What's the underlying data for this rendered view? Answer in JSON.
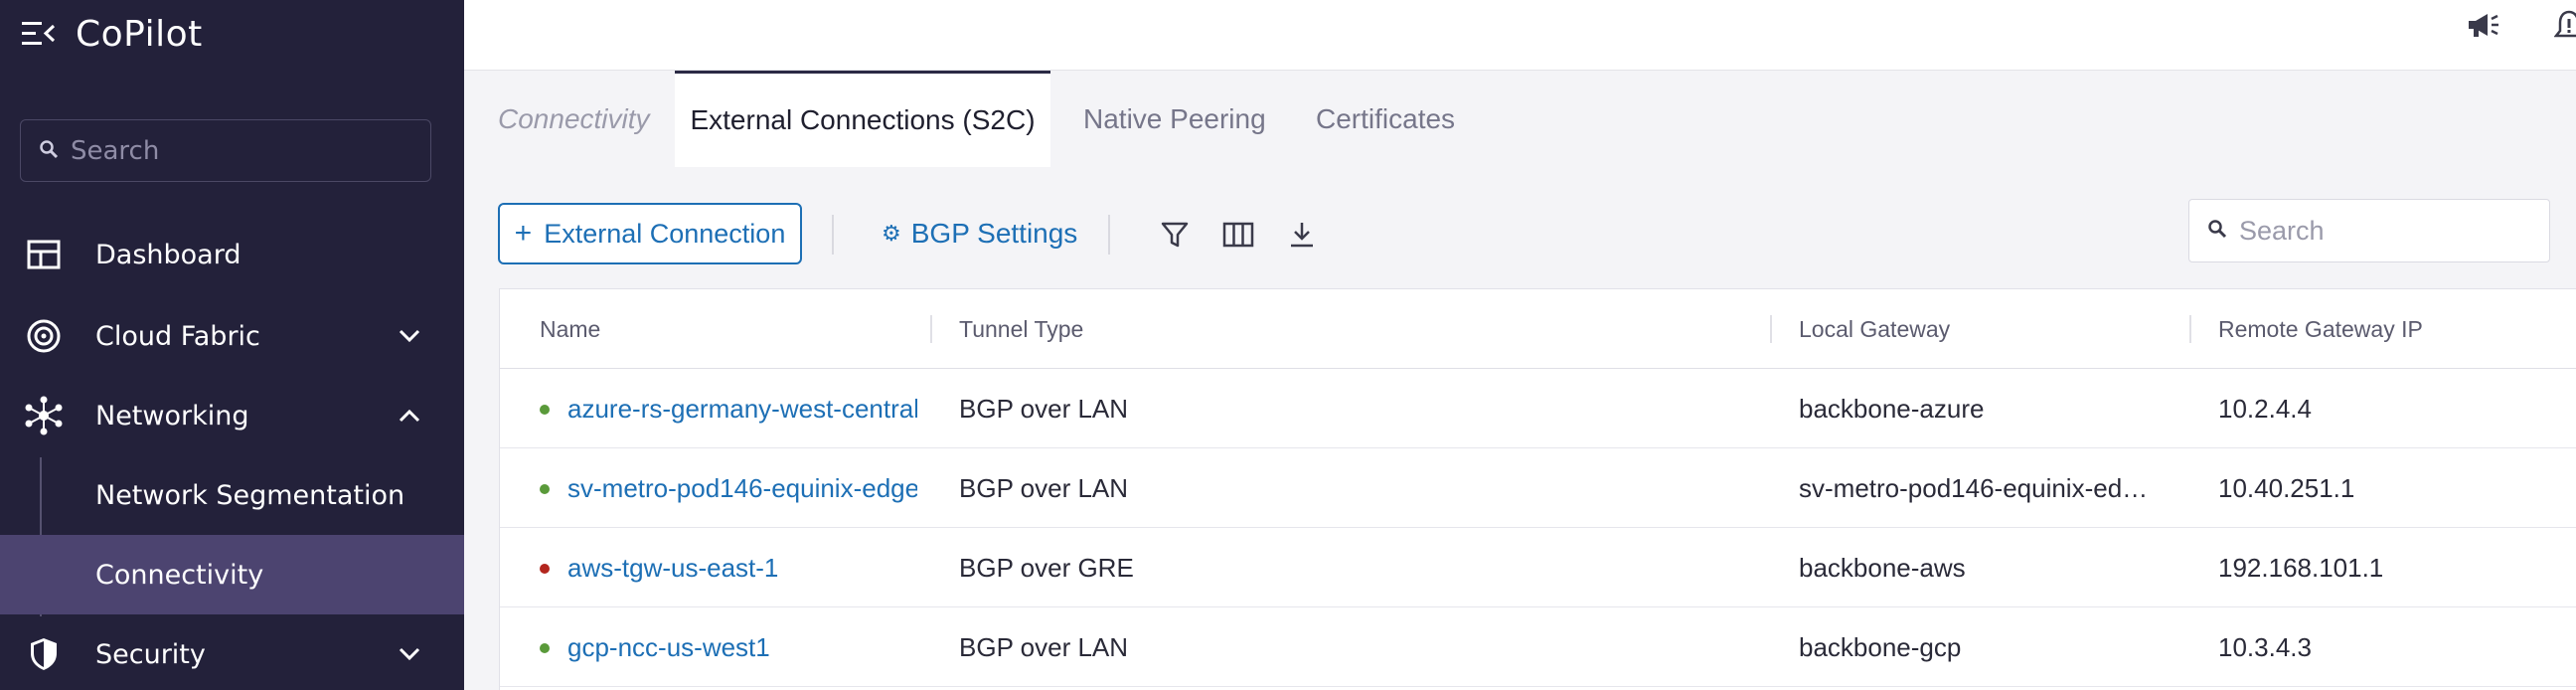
{
  "app": {
    "title": "CoPilot"
  },
  "sidebar": {
    "search_placeholder": "Search",
    "items": [
      {
        "label": "Dashboard",
        "icon": "dashboard-icon"
      },
      {
        "label": "Cloud Fabric",
        "icon": "cloud-fabric-icon",
        "expanded": false
      },
      {
        "label": "Networking",
        "icon": "networking-icon",
        "expanded": true
      },
      {
        "label": "Security",
        "icon": "shield-icon",
        "expanded": false
      }
    ],
    "networking_children": [
      {
        "label": "Network Segmentation",
        "active": false
      },
      {
        "label": "Connectivity",
        "active": true
      }
    ]
  },
  "tabs": [
    {
      "label": "Connectivity",
      "state": "italic"
    },
    {
      "label": "External Connections (S2C)",
      "state": "active"
    },
    {
      "label": "Native Peering",
      "state": "normal"
    },
    {
      "label": "Certificates",
      "state": "normal"
    }
  ],
  "toolbar": {
    "add_label": "External Connection",
    "bgp_label": "BGP Settings",
    "search_placeholder": "Search"
  },
  "table": {
    "columns": [
      "Name",
      "Tunnel Type",
      "Local Gateway",
      "Remote Gateway IP"
    ],
    "rows": [
      {
        "status": "up",
        "name": "azure-rs-germany-west-central",
        "tunnel": "BGP over LAN",
        "local": "backbone-azure",
        "remote": "10.2.4.4"
      },
      {
        "status": "up",
        "name": "sv-metro-pod146-equinix-edge",
        "tunnel": "BGP over LAN",
        "local": "sv-metro-pod146-equinix-ed…",
        "remote": "10.40.251.1"
      },
      {
        "status": "down",
        "name": "aws-tgw-us-east-1",
        "tunnel": "BGP over GRE",
        "local": "backbone-aws",
        "remote": "192.168.101.1"
      },
      {
        "status": "up",
        "name": "gcp-ncc-us-west1",
        "tunnel": "BGP over LAN",
        "local": "backbone-gcp",
        "remote": "10.3.4.3"
      }
    ]
  },
  "colors": {
    "sidebar_bg": "#23213a",
    "active_item": "#4c4470",
    "accent": "#1d6fb5",
    "status_up": "#5a9a3a",
    "status_down": "#b3261e"
  }
}
